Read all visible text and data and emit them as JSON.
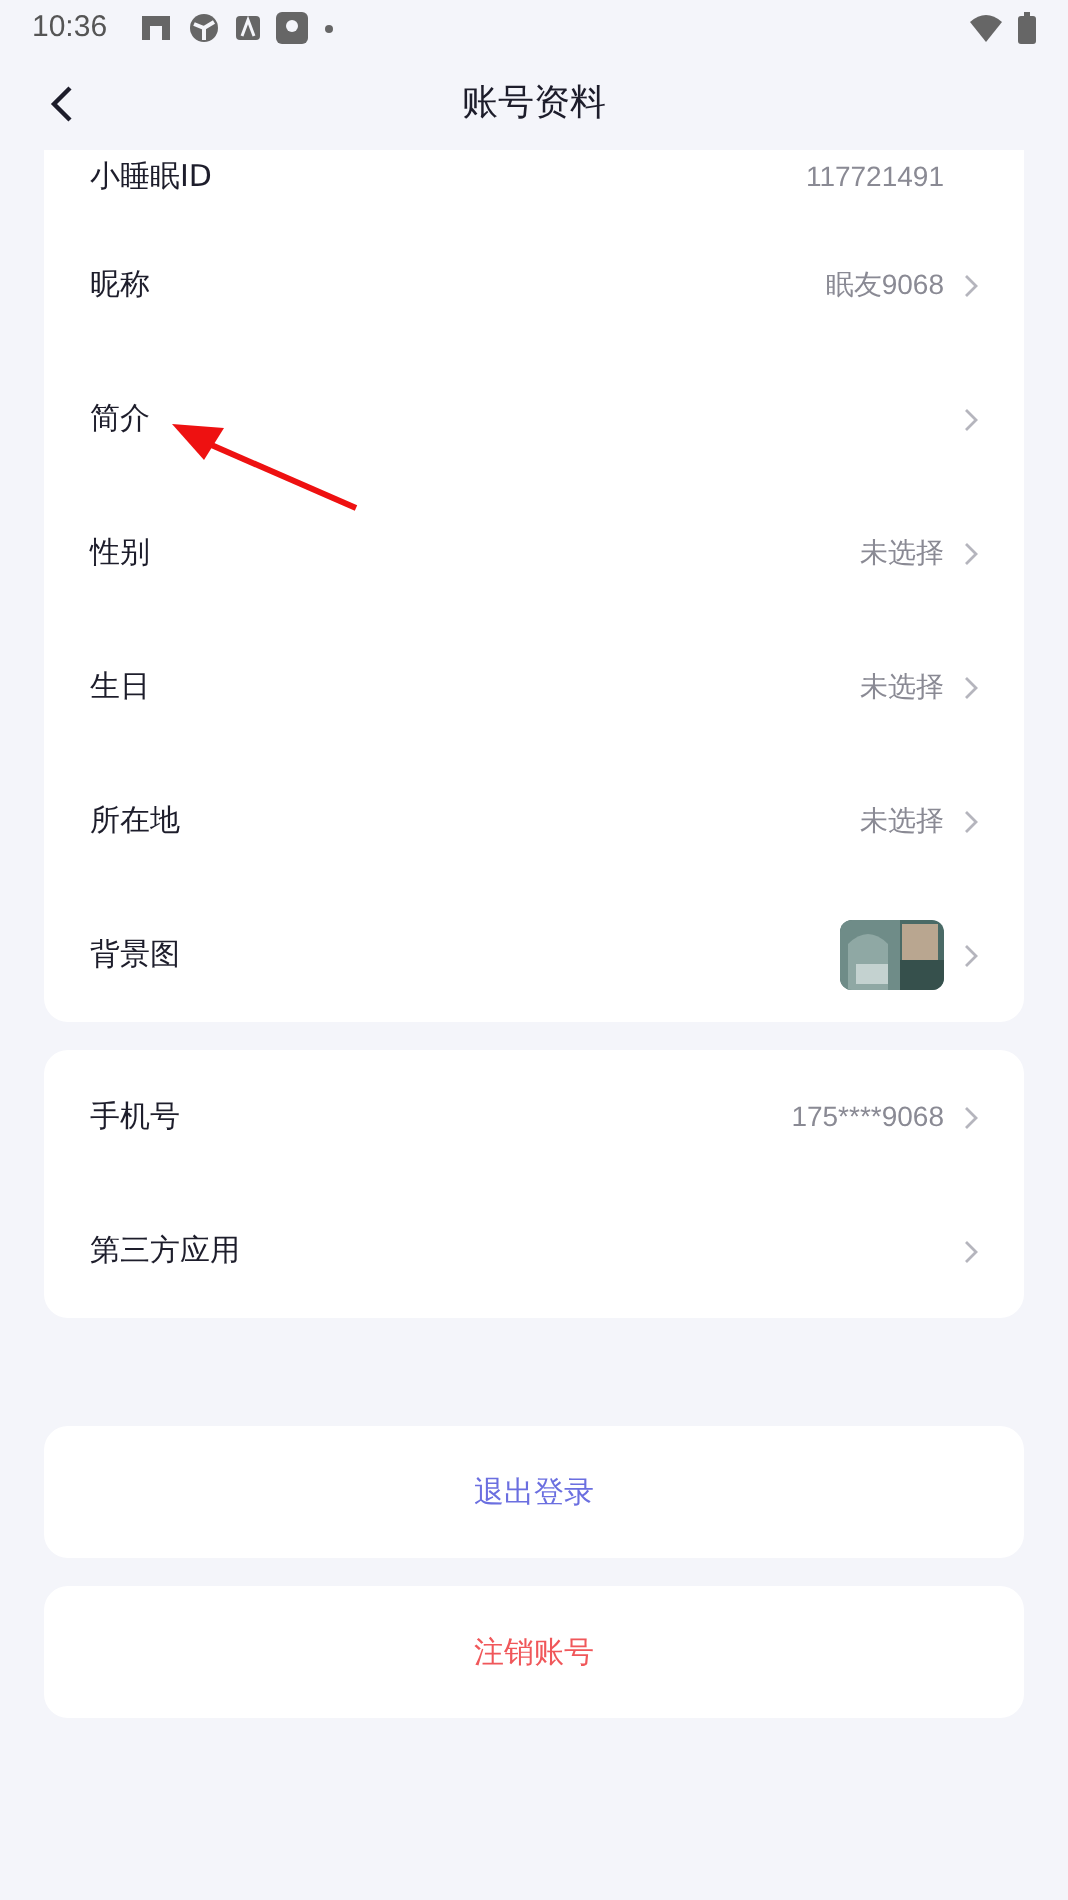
{
  "status_bar": {
    "time": "10:36"
  },
  "header": {
    "title": "账号资料"
  },
  "profile_card": [
    {
      "label": "小睡眠ID",
      "value": "117721491",
      "kind": "text"
    },
    {
      "label": "昵称",
      "value": "眠友9068",
      "kind": "link"
    },
    {
      "label": "简介",
      "kind": "link"
    },
    {
      "label": "性别",
      "value": "未选择",
      "kind": "link"
    },
    {
      "label": "生日",
      "value": "未选择",
      "kind": "link"
    },
    {
      "label": "所在地",
      "value": "未选择",
      "kind": "link"
    },
    {
      "label": "背景图"
    }
  ],
  "account_card": [
    {
      "label": "手机号",
      "value": "175****9068",
      "kind": "link"
    },
    {
      "label": "第三方应用",
      "kind": "link"
    }
  ],
  "actions": [
    {
      "label": "退出登录",
      "kind": "logout"
    },
    {
      "label": "注销账号",
      "kind": "delete"
    }
  ]
}
